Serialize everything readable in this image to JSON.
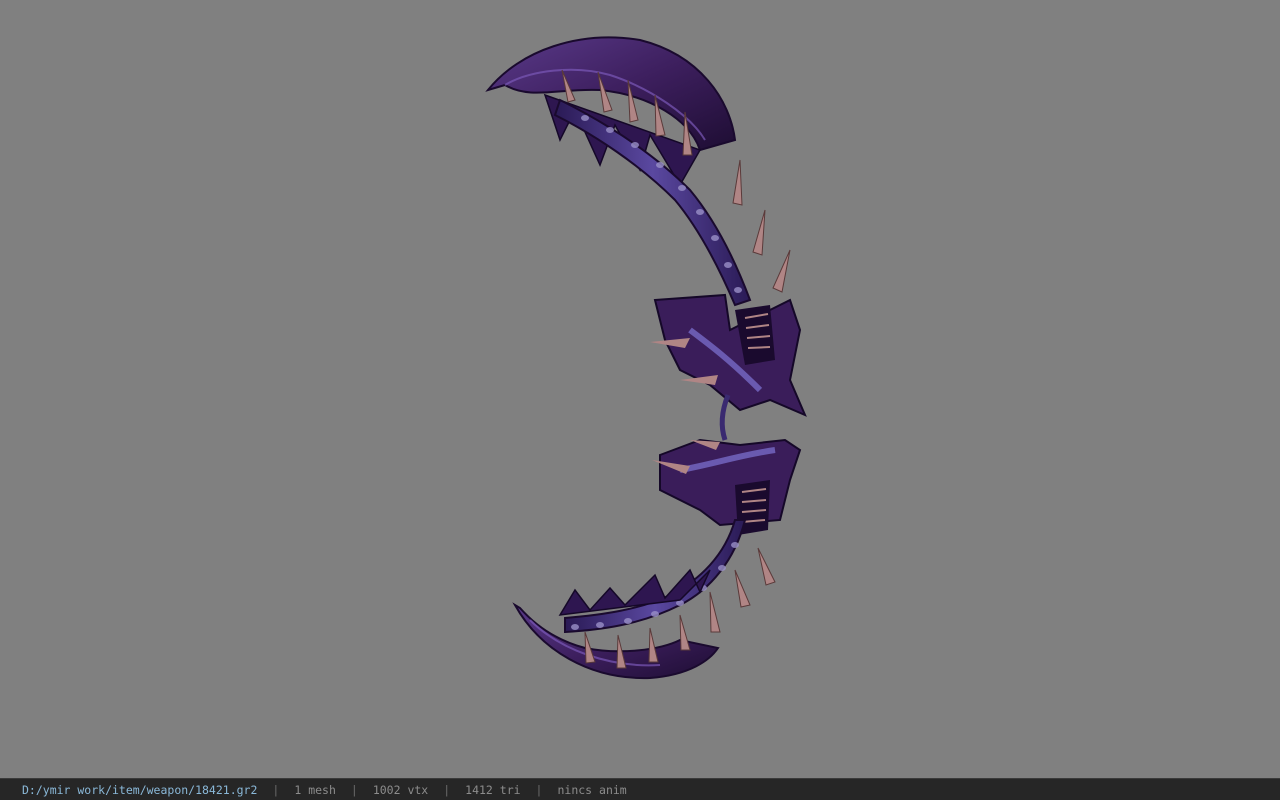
{
  "viewer": {
    "background_color": "#808080",
    "model": {
      "icon": "weapon-model-preview",
      "colors": {
        "primary": "#3d1f5e",
        "highlight": "#6a45a8",
        "dark": "#1e0d33",
        "spine": "#4b3a8e",
        "spike": "#b08585"
      }
    }
  },
  "status_bar": {
    "file_path": "D:/ymir work/item/weapon/18421.gr2",
    "separator": "|",
    "mesh_count": "1 mesh",
    "vertex_count": "1002 vtx",
    "triangle_count": "1412 tri",
    "anim_status": "nincs anim",
    "path_color": "#8ab8d8",
    "text_color": "#8c8c8c"
  }
}
